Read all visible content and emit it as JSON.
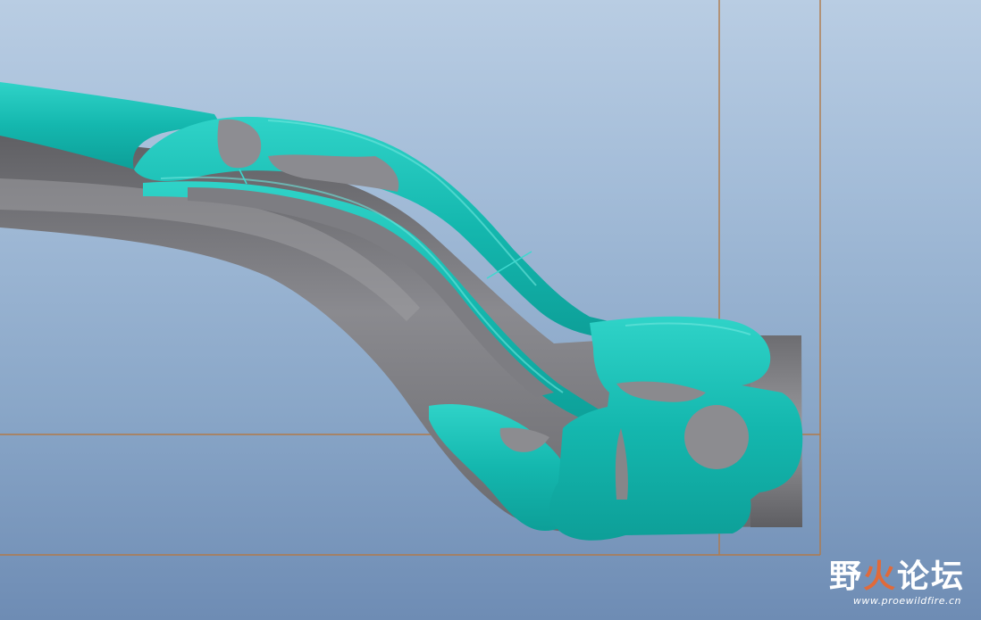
{
  "scene": {
    "background_top": "#b9cde3",
    "background_bottom": "#6e8cb4",
    "part_color": "#7f7f84",
    "scan_color": "#16bdb4",
    "datum_color": "#b07a4a"
  },
  "watermark": {
    "text_1": "野",
    "text_2": "火",
    "text_3": "论坛",
    "url": "www.proewildfire.cn",
    "icon": "flame-icon"
  }
}
